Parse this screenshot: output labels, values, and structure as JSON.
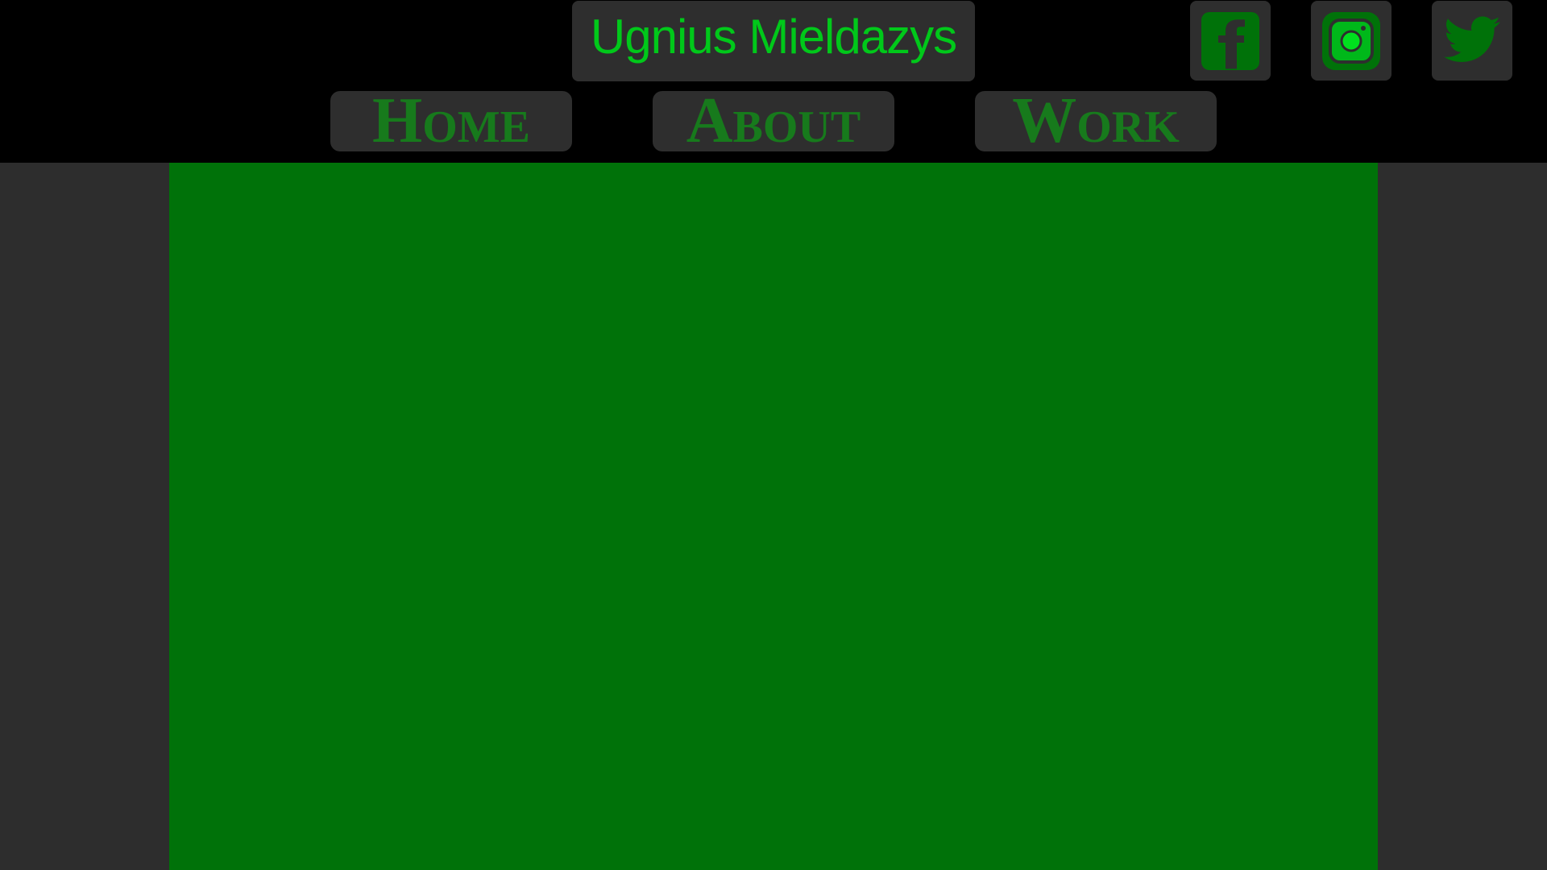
{
  "header": {
    "title": "Ugnius Mieldazys"
  },
  "nav": [
    {
      "label": "Home"
    },
    {
      "label": "About"
    },
    {
      "label": "Work"
    }
  ],
  "social": [
    {
      "icon": "facebook-icon"
    },
    {
      "icon": "instagram-icon"
    },
    {
      "icon": "twitter-icon"
    }
  ],
  "colors": {
    "title": "#00c81a",
    "nav_text": "#177a1c",
    "panel": "#007209",
    "button_bg": "#2e2e2e",
    "page_bg": "#2d2d2d"
  }
}
